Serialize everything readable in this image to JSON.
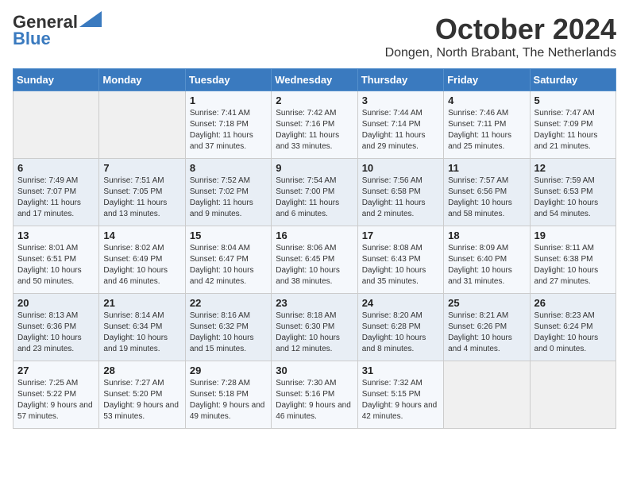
{
  "logo": {
    "line1": "General",
    "line2": "Blue"
  },
  "title": "October 2024",
  "location": "Dongen, North Brabant, The Netherlands",
  "headers": [
    "Sunday",
    "Monday",
    "Tuesday",
    "Wednesday",
    "Thursday",
    "Friday",
    "Saturday"
  ],
  "rows": [
    [
      {
        "day": "",
        "sunrise": "",
        "sunset": "",
        "daylight": ""
      },
      {
        "day": "",
        "sunrise": "",
        "sunset": "",
        "daylight": ""
      },
      {
        "day": "1",
        "sunrise": "Sunrise: 7:41 AM",
        "sunset": "Sunset: 7:18 PM",
        "daylight": "Daylight: 11 hours and 37 minutes."
      },
      {
        "day": "2",
        "sunrise": "Sunrise: 7:42 AM",
        "sunset": "Sunset: 7:16 PM",
        "daylight": "Daylight: 11 hours and 33 minutes."
      },
      {
        "day": "3",
        "sunrise": "Sunrise: 7:44 AM",
        "sunset": "Sunset: 7:14 PM",
        "daylight": "Daylight: 11 hours and 29 minutes."
      },
      {
        "day": "4",
        "sunrise": "Sunrise: 7:46 AM",
        "sunset": "Sunset: 7:11 PM",
        "daylight": "Daylight: 11 hours and 25 minutes."
      },
      {
        "day": "5",
        "sunrise": "Sunrise: 7:47 AM",
        "sunset": "Sunset: 7:09 PM",
        "daylight": "Daylight: 11 hours and 21 minutes."
      }
    ],
    [
      {
        "day": "6",
        "sunrise": "Sunrise: 7:49 AM",
        "sunset": "Sunset: 7:07 PM",
        "daylight": "Daylight: 11 hours and 17 minutes."
      },
      {
        "day": "7",
        "sunrise": "Sunrise: 7:51 AM",
        "sunset": "Sunset: 7:05 PM",
        "daylight": "Daylight: 11 hours and 13 minutes."
      },
      {
        "day": "8",
        "sunrise": "Sunrise: 7:52 AM",
        "sunset": "Sunset: 7:02 PM",
        "daylight": "Daylight: 11 hours and 9 minutes."
      },
      {
        "day": "9",
        "sunrise": "Sunrise: 7:54 AM",
        "sunset": "Sunset: 7:00 PM",
        "daylight": "Daylight: 11 hours and 6 minutes."
      },
      {
        "day": "10",
        "sunrise": "Sunrise: 7:56 AM",
        "sunset": "Sunset: 6:58 PM",
        "daylight": "Daylight: 11 hours and 2 minutes."
      },
      {
        "day": "11",
        "sunrise": "Sunrise: 7:57 AM",
        "sunset": "Sunset: 6:56 PM",
        "daylight": "Daylight: 10 hours and 58 minutes."
      },
      {
        "day": "12",
        "sunrise": "Sunrise: 7:59 AM",
        "sunset": "Sunset: 6:53 PM",
        "daylight": "Daylight: 10 hours and 54 minutes."
      }
    ],
    [
      {
        "day": "13",
        "sunrise": "Sunrise: 8:01 AM",
        "sunset": "Sunset: 6:51 PM",
        "daylight": "Daylight: 10 hours and 50 minutes."
      },
      {
        "day": "14",
        "sunrise": "Sunrise: 8:02 AM",
        "sunset": "Sunset: 6:49 PM",
        "daylight": "Daylight: 10 hours and 46 minutes."
      },
      {
        "day": "15",
        "sunrise": "Sunrise: 8:04 AM",
        "sunset": "Sunset: 6:47 PM",
        "daylight": "Daylight: 10 hours and 42 minutes."
      },
      {
        "day": "16",
        "sunrise": "Sunrise: 8:06 AM",
        "sunset": "Sunset: 6:45 PM",
        "daylight": "Daylight: 10 hours and 38 minutes."
      },
      {
        "day": "17",
        "sunrise": "Sunrise: 8:08 AM",
        "sunset": "Sunset: 6:43 PM",
        "daylight": "Daylight: 10 hours and 35 minutes."
      },
      {
        "day": "18",
        "sunrise": "Sunrise: 8:09 AM",
        "sunset": "Sunset: 6:40 PM",
        "daylight": "Daylight: 10 hours and 31 minutes."
      },
      {
        "day": "19",
        "sunrise": "Sunrise: 8:11 AM",
        "sunset": "Sunset: 6:38 PM",
        "daylight": "Daylight: 10 hours and 27 minutes."
      }
    ],
    [
      {
        "day": "20",
        "sunrise": "Sunrise: 8:13 AM",
        "sunset": "Sunset: 6:36 PM",
        "daylight": "Daylight: 10 hours and 23 minutes."
      },
      {
        "day": "21",
        "sunrise": "Sunrise: 8:14 AM",
        "sunset": "Sunset: 6:34 PM",
        "daylight": "Daylight: 10 hours and 19 minutes."
      },
      {
        "day": "22",
        "sunrise": "Sunrise: 8:16 AM",
        "sunset": "Sunset: 6:32 PM",
        "daylight": "Daylight: 10 hours and 15 minutes."
      },
      {
        "day": "23",
        "sunrise": "Sunrise: 8:18 AM",
        "sunset": "Sunset: 6:30 PM",
        "daylight": "Daylight: 10 hours and 12 minutes."
      },
      {
        "day": "24",
        "sunrise": "Sunrise: 8:20 AM",
        "sunset": "Sunset: 6:28 PM",
        "daylight": "Daylight: 10 hours and 8 minutes."
      },
      {
        "day": "25",
        "sunrise": "Sunrise: 8:21 AM",
        "sunset": "Sunset: 6:26 PM",
        "daylight": "Daylight: 10 hours and 4 minutes."
      },
      {
        "day": "26",
        "sunrise": "Sunrise: 8:23 AM",
        "sunset": "Sunset: 6:24 PM",
        "daylight": "Daylight: 10 hours and 0 minutes."
      }
    ],
    [
      {
        "day": "27",
        "sunrise": "Sunrise: 7:25 AM",
        "sunset": "Sunset: 5:22 PM",
        "daylight": "Daylight: 9 hours and 57 minutes."
      },
      {
        "day": "28",
        "sunrise": "Sunrise: 7:27 AM",
        "sunset": "Sunset: 5:20 PM",
        "daylight": "Daylight: 9 hours and 53 minutes."
      },
      {
        "day": "29",
        "sunrise": "Sunrise: 7:28 AM",
        "sunset": "Sunset: 5:18 PM",
        "daylight": "Daylight: 9 hours and 49 minutes."
      },
      {
        "day": "30",
        "sunrise": "Sunrise: 7:30 AM",
        "sunset": "Sunset: 5:16 PM",
        "daylight": "Daylight: 9 hours and 46 minutes."
      },
      {
        "day": "31",
        "sunrise": "Sunrise: 7:32 AM",
        "sunset": "Sunset: 5:15 PM",
        "daylight": "Daylight: 9 hours and 42 minutes."
      },
      {
        "day": "",
        "sunrise": "",
        "sunset": "",
        "daylight": ""
      },
      {
        "day": "",
        "sunrise": "",
        "sunset": "",
        "daylight": ""
      }
    ]
  ]
}
